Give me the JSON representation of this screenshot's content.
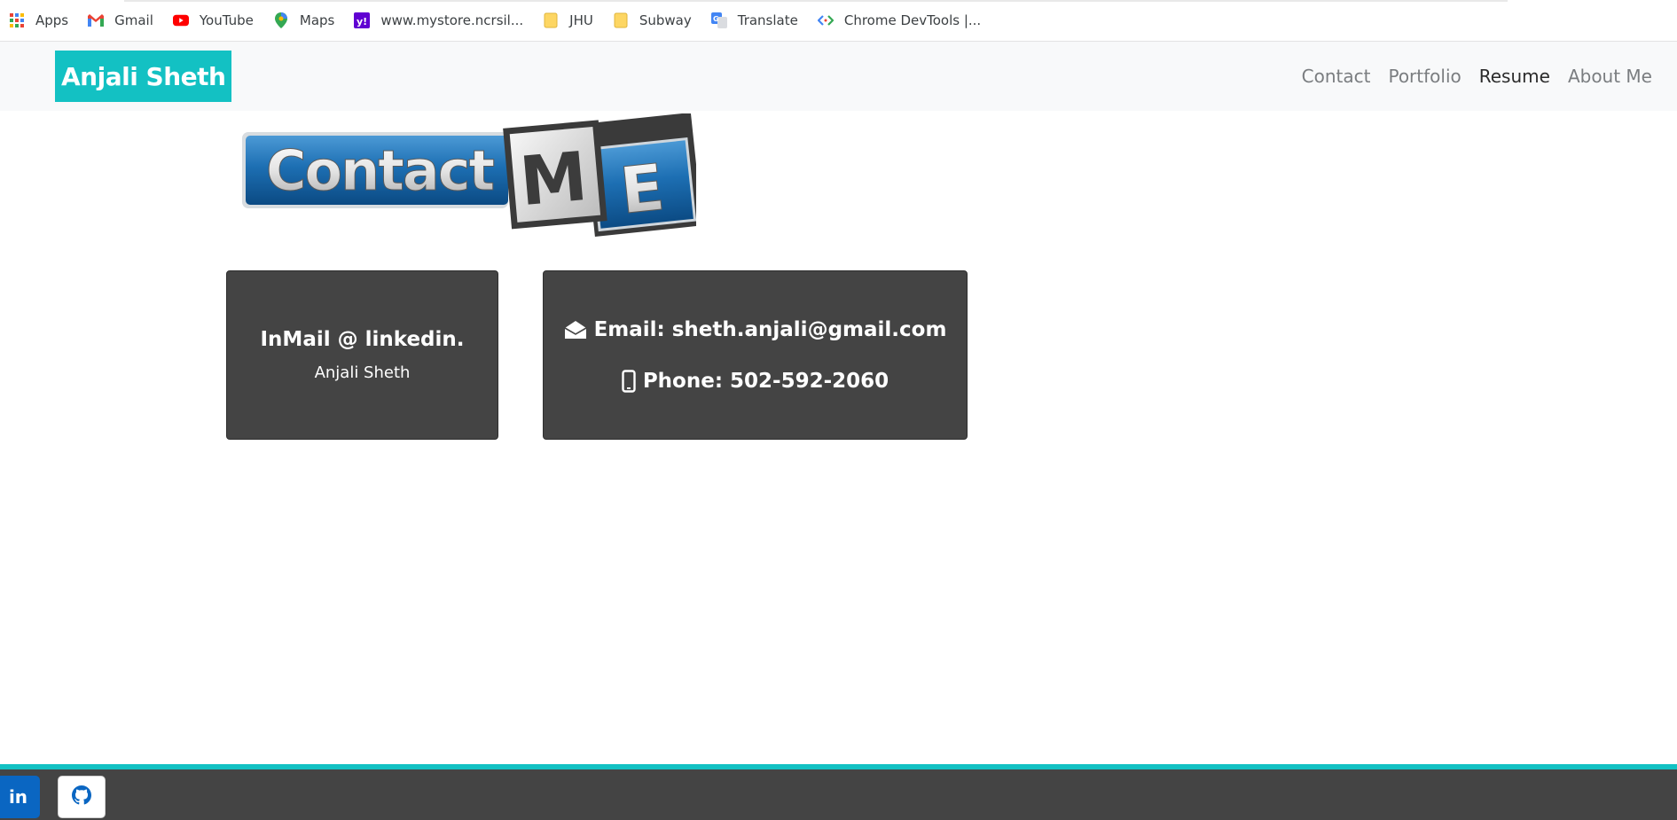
{
  "bookmarks": [
    {
      "label": "Apps",
      "icon": "apps-grid-icon"
    },
    {
      "label": "Gmail",
      "icon": "gmail-icon"
    },
    {
      "label": "YouTube",
      "icon": "youtube-icon"
    },
    {
      "label": "Maps",
      "icon": "maps-pin-icon"
    },
    {
      "label": "www.mystore.ncrsil...",
      "icon": "yahoo-icon"
    },
    {
      "label": "JHU",
      "icon": "folder-icon"
    },
    {
      "label": "Subway",
      "icon": "folder-icon"
    },
    {
      "label": "Translate",
      "icon": "translate-icon"
    },
    {
      "label": "Chrome DevTools |...",
      "icon": "devtools-icon"
    }
  ],
  "navbar": {
    "brand": "Anjali Sheth",
    "links": [
      "Contact",
      "Portfolio",
      "Resume",
      "About Me"
    ],
    "active_link": "Resume"
  },
  "banner": {
    "word": "Contact",
    "letter_m": "M",
    "letter_e": "E"
  },
  "linkedin_card": {
    "title": "InMail @ linkedin.",
    "subtitle": "Anjali Sheth"
  },
  "contact_card": {
    "email": "Email: sheth.anjali@gmail.com",
    "phone": "Phone: 502-592-2060"
  },
  "footer": {
    "linkedin_icon_text": "in"
  },
  "colors": {
    "accent": "#13c1c3",
    "card_bg": "#444444",
    "footer_bg": "#444444",
    "linkedin_blue": "#0a66c2"
  }
}
